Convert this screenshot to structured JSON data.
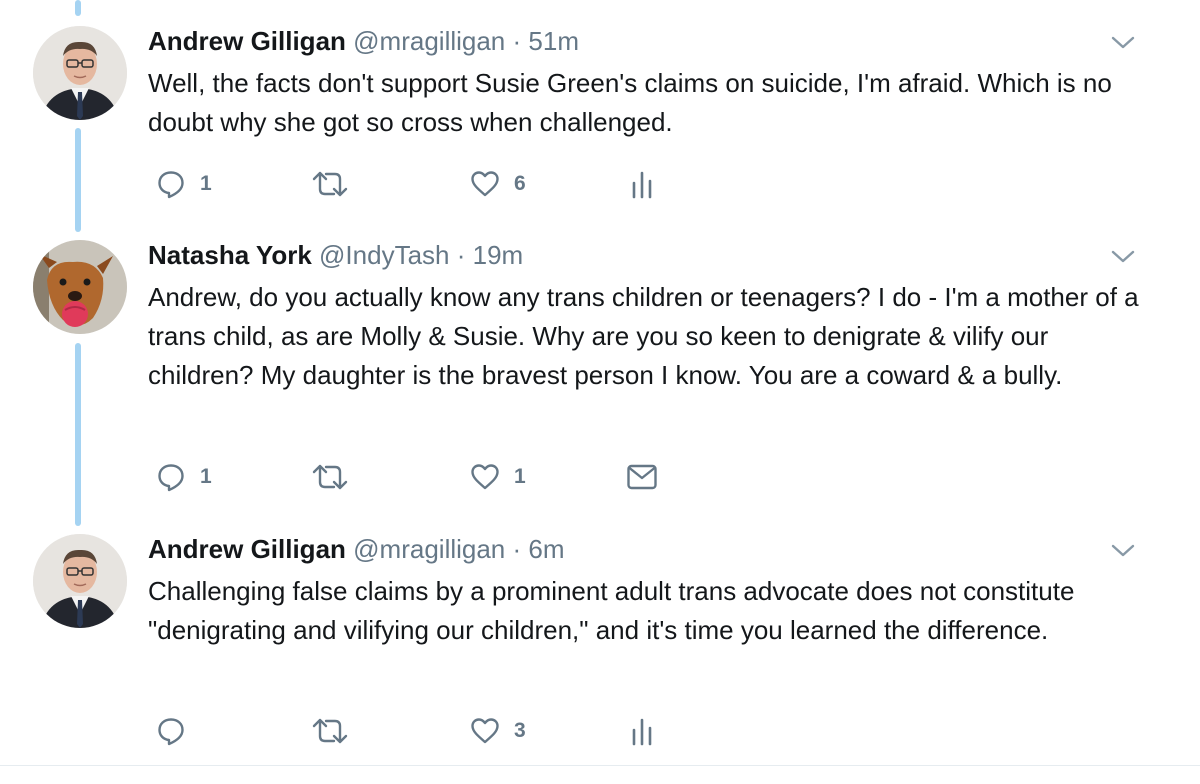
{
  "tweets": [
    {
      "name": "Andrew Gilligan",
      "handle": "@mragilligan",
      "separator": "·",
      "time": "51m",
      "text": "Well, the facts don't support Susie Green's claims on suicide, I'm afraid. Which is no doubt why she got so cross when challenged.",
      "reply_count": "1",
      "retweet_count": "",
      "like_count": "6",
      "third_action_icon": "analytics-icon"
    },
    {
      "name": "Natasha York",
      "handle": "@IndyTash",
      "separator": "·",
      "time": "19m",
      "text": "Andrew, do you actually know any trans children or teenagers? I do - I'm a mother of a trans child, as are Molly & Susie. Why are you so keen to denigrate & vilify our children? My daughter is the bravest person I know. You are a coward & a bully.",
      "reply_count": "1",
      "retweet_count": "",
      "like_count": "1",
      "third_action_icon": "direct-message-icon"
    },
    {
      "name": "Andrew Gilligan",
      "handle": "@mragilligan",
      "separator": "·",
      "time": "6m",
      "text": "Challenging false claims by a prominent adult trans advocate does not constitute \"denigrating and vilifying our children,\" and it's time you learned the difference.",
      "reply_count": "",
      "retweet_count": "",
      "like_count": "3",
      "third_action_icon": "analytics-icon"
    }
  ],
  "colors": {
    "thread_line": "#a5d3f2",
    "icon_gray": "#657786",
    "text": "#14171a"
  }
}
